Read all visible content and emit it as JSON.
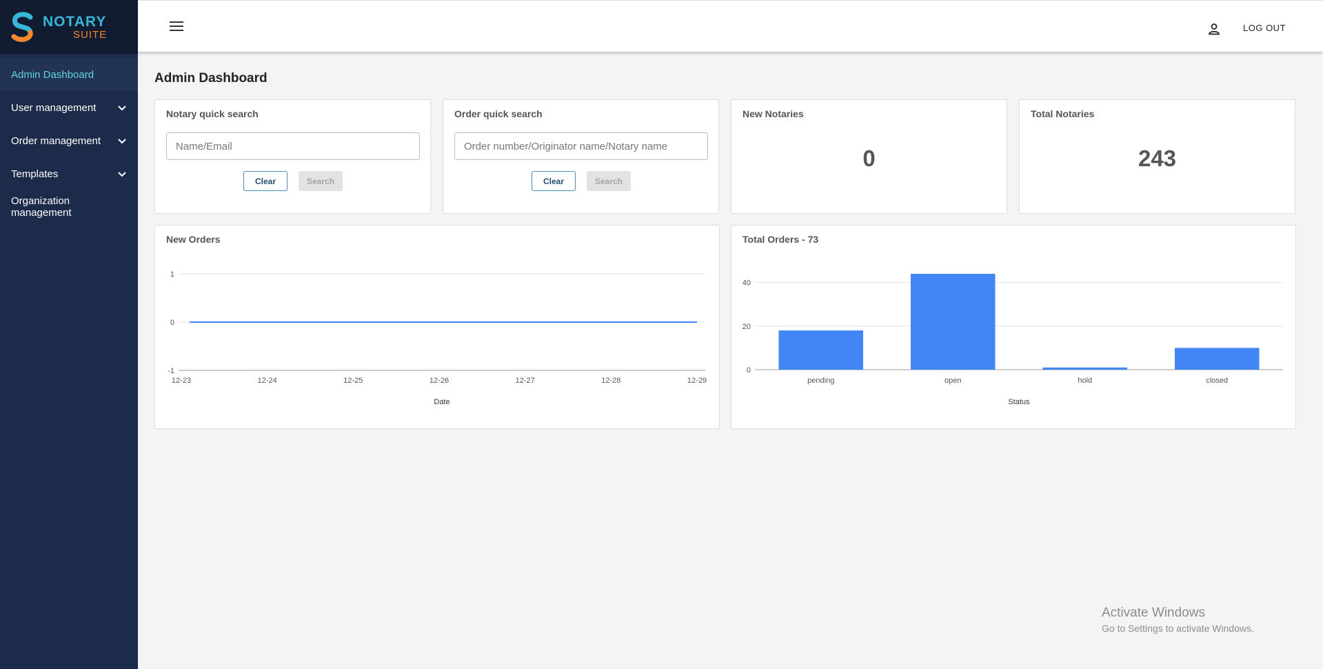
{
  "logo": {
    "line1": "NOTARY",
    "line2": "SUITE"
  },
  "sidebar": {
    "items": [
      {
        "label": "Admin Dashboard",
        "active": true,
        "expandable": false
      },
      {
        "label": "User management",
        "active": false,
        "expandable": true
      },
      {
        "label": "Order management",
        "active": false,
        "expandable": true
      },
      {
        "label": "Templates",
        "active": false,
        "expandable": true
      },
      {
        "label": "Organization management",
        "active": false,
        "expandable": false
      }
    ]
  },
  "header": {
    "logout_label": "LOG OUT",
    "menu_icon": "menu-icon",
    "user_icon": "person-icon"
  },
  "page": {
    "title": "Admin Dashboard"
  },
  "notary_search": {
    "title": "Notary quick search",
    "placeholder": "Name/Email",
    "clear_label": "Clear",
    "search_label": "Search"
  },
  "order_search": {
    "title": "Order quick search",
    "placeholder": "Order number/Originator name/Notary name",
    "clear_label": "Clear",
    "search_label": "Search"
  },
  "new_notaries": {
    "title": "New Notaries",
    "value": "0"
  },
  "total_notaries": {
    "title": "Total Notaries",
    "value": "243"
  },
  "new_orders": {
    "title": "New Orders"
  },
  "total_orders": {
    "title": "Total Orders - 73"
  },
  "colors": {
    "accent": "#5fd3e5",
    "sidebar": "#1c2b4a",
    "series": "#4285f4"
  },
  "watermark": {
    "line1": "Activate Windows",
    "line2": "Go to Settings to activate Windows."
  },
  "chart_data": [
    {
      "type": "line",
      "title": "New Orders",
      "x": [
        "12-23",
        "12-24",
        "12-25",
        "12-26",
        "12-27",
        "12-28",
        "12-29"
      ],
      "series": [
        {
          "values": [
            0,
            0,
            0,
            0,
            0,
            0,
            0
          ]
        }
      ],
      "xlabel": "Date",
      "ylabel": "",
      "ylim": [
        -1,
        1
      ],
      "yticks": [
        1,
        0,
        -1
      ],
      "grid": true
    },
    {
      "type": "bar",
      "title": "Total Orders - 73",
      "categories": [
        "pending",
        "open",
        "hold",
        "closed"
      ],
      "values": [
        18,
        44,
        1,
        10
      ],
      "xlabel": "Status",
      "ylabel": "",
      "ylim": [
        0,
        44
      ],
      "yticks": [
        40,
        20,
        0
      ],
      "grid": true
    }
  ]
}
